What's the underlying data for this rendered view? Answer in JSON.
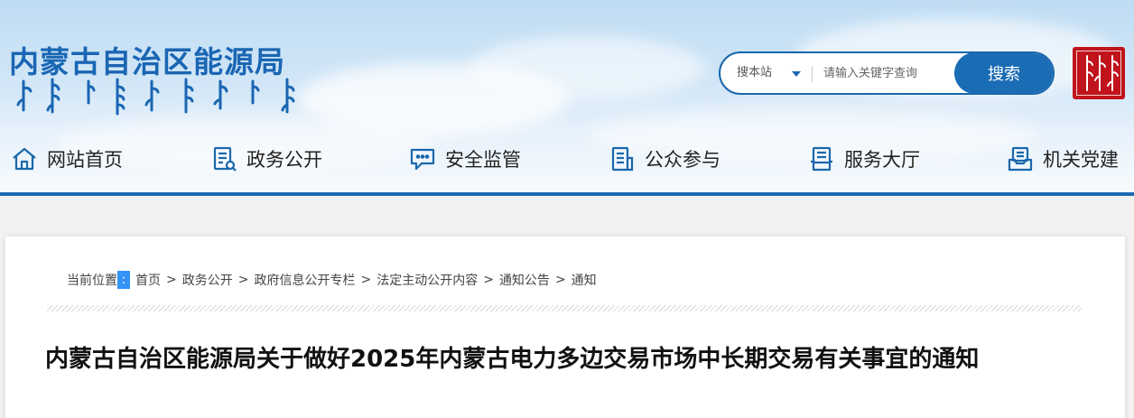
{
  "header": {
    "site_title": "内蒙古自治区能源局",
    "search": {
      "scope_label": "搜本站",
      "placeholder": "请输入关键字查询",
      "button_label": "搜索"
    }
  },
  "nav": {
    "items": [
      {
        "label": "网站首页",
        "icon": "home-icon"
      },
      {
        "label": "政务公开",
        "icon": "document-icon"
      },
      {
        "label": "安全监管",
        "icon": "chat-icon"
      },
      {
        "label": "公众参与",
        "icon": "clipboard-icon"
      },
      {
        "label": "服务大厅",
        "icon": "service-icon"
      },
      {
        "label": "机关党建",
        "icon": "inbox-icon"
      }
    ]
  },
  "breadcrumb": {
    "prefix": "当前位置",
    "colon": ":",
    "separator": ">",
    "items": [
      "首页",
      "政务公开",
      "政府信息公开专栏",
      "法定主动公开内容",
      "通知公告",
      "通知"
    ]
  },
  "article": {
    "title": "内蒙古自治区能源局关于做好2025年内蒙古电力多边交易市场中长期交易有关事宜的通知"
  },
  "colors": {
    "brand_blue": "#1a6cb5",
    "nav_rule": "#1d6ab3",
    "seal_red": "#c0131b"
  }
}
